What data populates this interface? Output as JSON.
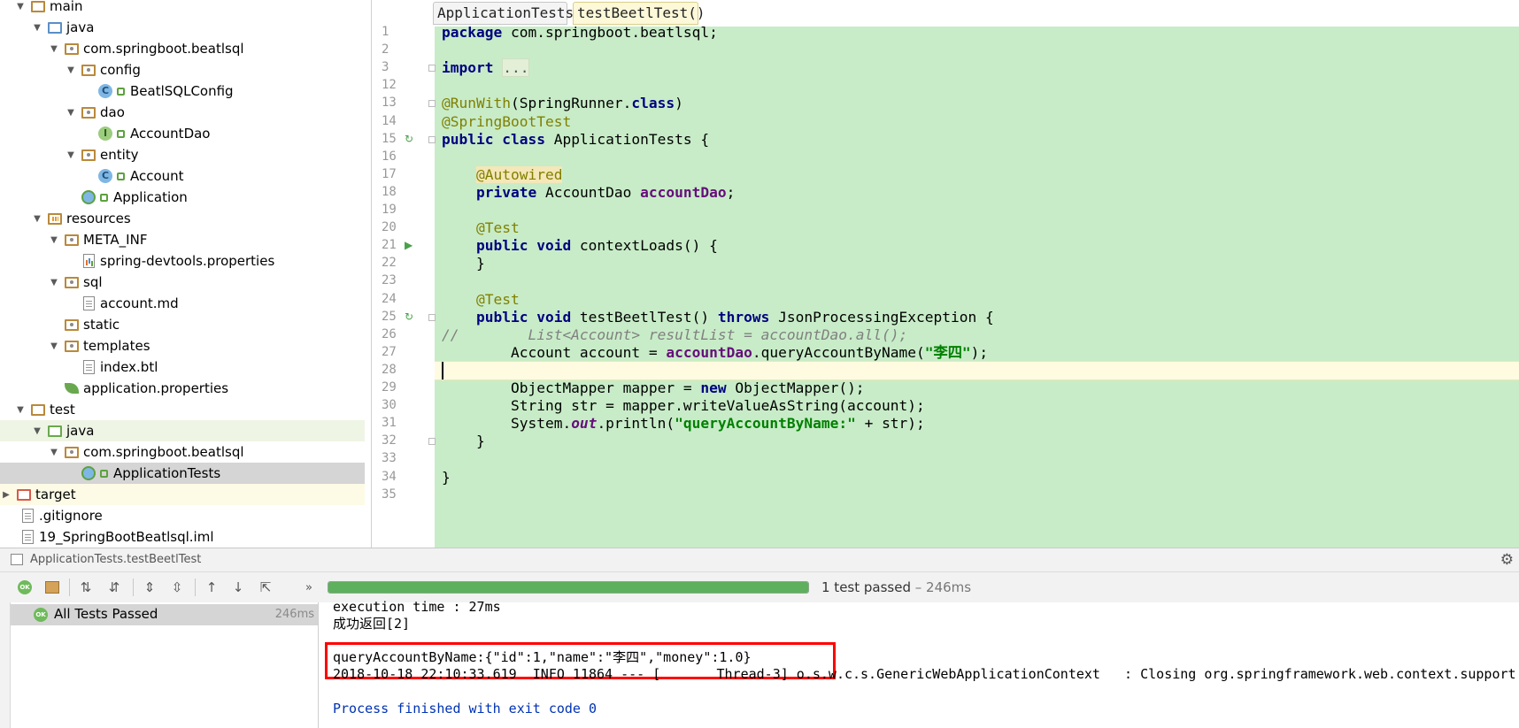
{
  "project_tree": [
    {
      "label": "main",
      "kind": "folder",
      "indent": 0,
      "expanded": true
    },
    {
      "label": "java",
      "kind": "folder-blue",
      "indent": 1,
      "expanded": true
    },
    {
      "label": "com.springboot.beatlsql",
      "kind": "package",
      "indent": 2,
      "expanded": true
    },
    {
      "label": "config",
      "kind": "package",
      "indent": 3,
      "expanded": true
    },
    {
      "label": "BeatlSQLConfig",
      "kind": "class",
      "indent": 4
    },
    {
      "label": "dao",
      "kind": "package",
      "indent": 3,
      "expanded": true
    },
    {
      "label": "AccountDao",
      "kind": "interface",
      "indent": 4
    },
    {
      "label": "entity",
      "kind": "package",
      "indent": 3,
      "expanded": true
    },
    {
      "label": "Account",
      "kind": "class",
      "indent": 4
    },
    {
      "label": "Application",
      "kind": "boot-class",
      "indent": 3
    },
    {
      "label": "resources",
      "kind": "resources",
      "indent": 1,
      "expanded": true
    },
    {
      "label": "META_INF",
      "kind": "package",
      "indent": 2,
      "expanded": true
    },
    {
      "label": "spring-devtools.properties",
      "kind": "properties",
      "indent": 3
    },
    {
      "label": "sql",
      "kind": "package",
      "indent": 2,
      "expanded": true
    },
    {
      "label": "account.md",
      "kind": "file",
      "indent": 3
    },
    {
      "label": "static",
      "kind": "package",
      "indent": 2
    },
    {
      "label": "templates",
      "kind": "package",
      "indent": 2,
      "expanded": true
    },
    {
      "label": "index.btl",
      "kind": "file",
      "indent": 3
    },
    {
      "label": "application.properties",
      "kind": "spring-properties",
      "indent": 2
    },
    {
      "label": "test",
      "kind": "folder",
      "indent": 0,
      "expanded": true
    },
    {
      "label": "java",
      "kind": "folder-green",
      "indent": 1,
      "expanded": true,
      "row_style": "green"
    },
    {
      "label": "com.springboot.beatlsql",
      "kind": "package",
      "indent": 2,
      "expanded": true
    },
    {
      "label": "ApplicationTests",
      "kind": "test-class",
      "indent": 3,
      "row_style": "selected"
    },
    {
      "label": "target",
      "kind": "folder-red",
      "indent": -1,
      "collapsed": true,
      "row_style": "yellow"
    },
    {
      "label": ".gitignore",
      "kind": "file",
      "indent": -1
    },
    {
      "label": "19_SpringBootBeatlsql.iml",
      "kind": "file",
      "indent": -1
    }
  ],
  "editor": {
    "tabs": [
      "ApplicationTests",
      "testBeetlTest()"
    ],
    "active_tab": 1,
    "current_line": "28",
    "lines": [
      {
        "no": "1",
        "html": "<span class=\"kw\">package</span> com.springboot.beatlsql;"
      },
      {
        "no": "2",
        "html": ""
      },
      {
        "no": "3",
        "html": "<span class=\"kw\">import</span> <span class=\"foldtxt\">...</span>"
      },
      {
        "no": "12",
        "html": ""
      },
      {
        "no": "13",
        "html": "<span class=\"ann\">@RunWith</span>(SpringRunner.<span class=\"kw\">class</span>)"
      },
      {
        "no": "14",
        "html": "<span class=\"ann\">@SpringBootTest</span>"
      },
      {
        "no": "15",
        "html": "<span class=\"kw\">public class</span> ApplicationTests {"
      },
      {
        "no": "16",
        "html": ""
      },
      {
        "no": "17",
        "html": "    <span class=\"annbg\">@Autowired</span>"
      },
      {
        "no": "18",
        "html": "    <span class=\"kw\">private</span> AccountDao <span class=\"field\">accountDao</span>;"
      },
      {
        "no": "19",
        "html": ""
      },
      {
        "no": "20",
        "html": "    <span class=\"ann\">@Test</span>"
      },
      {
        "no": "21",
        "html": "    <span class=\"kw\">public void</span> contextLoads() {"
      },
      {
        "no": "22",
        "html": "    }"
      },
      {
        "no": "23",
        "html": ""
      },
      {
        "no": "24",
        "html": "    <span class=\"ann\">@Test</span>"
      },
      {
        "no": "25",
        "html": "    <span class=\"kw\">public void</span> testBeetlTest() <span class=\"kw\">throws</span> JsonProcessingException {"
      },
      {
        "no": "26",
        "html": "<span class=\"cmt\">//        List&lt;Account&gt; resultList = accountDao.all();</span>"
      },
      {
        "no": "27",
        "html": "        Account account = <span class=\"field\">accountDao</span>.queryAccountByName(<span class=\"str\">\"李四\"</span>);"
      },
      {
        "no": "28",
        "html": ""
      },
      {
        "no": "29",
        "html": "        ObjectMapper mapper = <span class=\"kw\">new</span> ObjectMapper();"
      },
      {
        "no": "30",
        "html": "        String str = mapper.writeValueAsString(account);"
      },
      {
        "no": "31",
        "html": "        System.<span class=\"staticf\">out</span>.println(<span class=\"str\">\"queryAccountByName:\"</span> + str);"
      },
      {
        "no": "32",
        "html": "    }"
      },
      {
        "no": "33",
        "html": ""
      },
      {
        "no": "34",
        "html": "}"
      },
      {
        "no": "35",
        "html": ""
      }
    ]
  },
  "run": {
    "header_title": "ApplicationTests.testBeetlTest",
    "progress_fraction": 1.0,
    "status_text": "1 test passed",
    "status_time": " – 246ms",
    "left_pane": {
      "label": "All Tests Passed",
      "time": "246ms"
    },
    "console": [
      {
        "text": "execution time : 27ms",
        "style": "normal"
      },
      {
        "text": "成功返回[2]",
        "style": "normal"
      },
      {
        "text": "",
        "style": "normal"
      },
      {
        "text": "queryAccountByName:{\"id\":1,\"name\":\"李四\",\"money\":1.0}",
        "style": "normal"
      },
      {
        "text": "2018-10-18 22:10:33.619  INFO 11864 --- [       Thread-3] o.s.w.c.s.GenericWebApplicationContext   : Closing org.springframework.web.context.support.",
        "style": "normal"
      },
      {
        "text": "",
        "style": "normal"
      },
      {
        "text": "Process finished with exit code 0",
        "style": "blue"
      }
    ]
  },
  "colors": {
    "editor_bg": "#c8ecc8",
    "current_line": "#fffbe0",
    "progress_fill": "#5eb05e",
    "highlight_box": "#ff0000"
  }
}
